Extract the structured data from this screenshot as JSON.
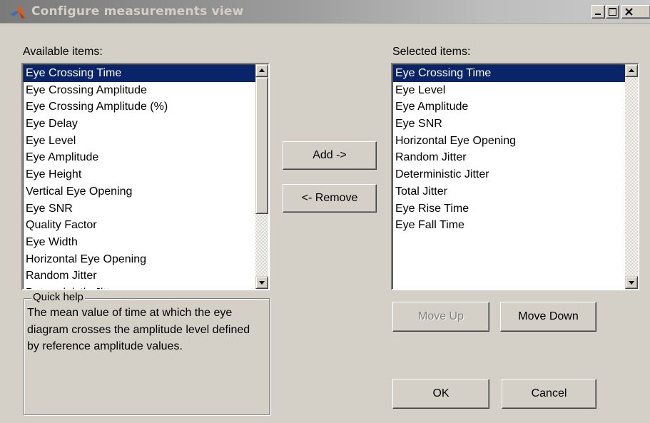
{
  "window": {
    "title": "Configure measurements view",
    "controls": {
      "minimize_icon": "minimize-icon",
      "maximize_icon": "maximize-icon",
      "close_icon": "close-icon"
    }
  },
  "available": {
    "label": "Available items:",
    "selected_index": 0,
    "items": [
      "Eye Crossing Time",
      "Eye Crossing Amplitude",
      "Eye Crossing Amplitude (%)",
      "Eye Delay",
      "Eye Level",
      "Eye Amplitude",
      "Eye Height",
      "Vertical Eye Opening",
      "Eye SNR",
      "Quality Factor",
      "Eye Width",
      "Horizontal Eye Opening",
      "Random Jitter",
      "Deterministic Jitter"
    ]
  },
  "selected": {
    "label": "Selected items:",
    "selected_index": 0,
    "items": [
      "Eye Crossing Time",
      "Eye Level",
      "Eye Amplitude",
      "Eye SNR",
      "Horizontal Eye Opening",
      "Random Jitter",
      "Deterministic Jitter",
      "Total Jitter",
      "Eye Rise Time",
      "Eye Fall Time"
    ]
  },
  "buttons": {
    "add": "Add ->",
    "remove": "<- Remove",
    "move_up": "Move Up",
    "move_down": "Move Down",
    "ok": "OK",
    "cancel": "Cancel"
  },
  "quick_help": {
    "title": "Quick help",
    "text": "The mean value of time at which the eye diagram crosses the amplitude level defined by reference amplitude values."
  },
  "colors": {
    "selection": "#0a246a",
    "face": "#d4d0c8"
  }
}
